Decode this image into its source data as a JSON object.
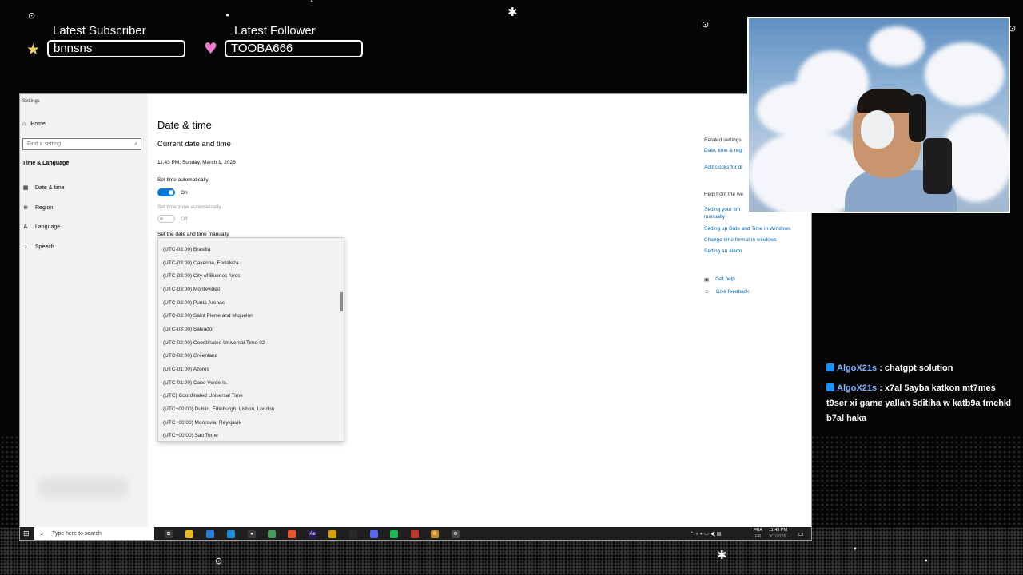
{
  "overlay": {
    "subscriber": {
      "title": "Latest Subscriber",
      "name": "bnnsns"
    },
    "follower": {
      "title": "Latest Follower",
      "name": "TOOBA666"
    }
  },
  "settings": {
    "window_title": "Settings",
    "home": "Home",
    "search_placeholder": "Find a setting",
    "section": "Time & Language",
    "nav": [
      {
        "label": "Date & time",
        "icon": "calendar-icon"
      },
      {
        "label": "Region",
        "icon": "globe-icon"
      },
      {
        "label": "Language",
        "icon": "language-icon"
      },
      {
        "label": "Speech",
        "icon": "microphone-icon"
      }
    ],
    "page_title": "Date & time",
    "current_heading": "Current date and time",
    "current_value": "11:43 PM, Sunday, March 1, 2026",
    "set_time_auto_label": "Set time automatically",
    "set_time_auto_state": "On",
    "set_tz_auto_label": "Set time zone automatically",
    "set_tz_auto_state": "Off",
    "manual_label": "Set the date and time manually",
    "timezones": [
      "(UTC-03:00) Brasilia",
      "(UTC-03:00) Cayenne, Fortaleza",
      "(UTC-03:00) City of Buenos Aires",
      "(UTC-03:00) Montevideo",
      "(UTC-03:00) Punta Arenas",
      "(UTC-03:00) Saint Pierre and Miquelon",
      "(UTC-03:00) Salvador",
      "(UTC-02:00) Coordinated Universal Time-02",
      "(UTC-02:00) Greenland",
      "(UTC-01:00) Azores",
      "(UTC-01:00) Cabo Verde Is.",
      "(UTC) Coordinated Universal Time",
      "(UTC+00:00) Dublin, Edinburgh, Lisbon, London",
      "(UTC+00:00) Monrovia, Reykjavik",
      "(UTC+00:00) Sao Tome"
    ],
    "related_title": "Related settings",
    "related_links": [
      "Date, time & regi",
      "Add clocks for di"
    ],
    "help_title": "Help from the we",
    "help_links": [
      "Setting your tim",
      "manually",
      "Setting up Date and Time in Windows",
      "Change time format in windows",
      "Setting an alarm"
    ],
    "get_help": "Get help",
    "give_feedback": "Give feedback"
  },
  "taskbar": {
    "search_placeholder": "Type here to search",
    "apps": [
      {
        "name": "task-view-icon",
        "color": "#3a3a3a",
        "glyph": "⧉"
      },
      {
        "name": "file-explorer-icon",
        "color": "#e8b92a",
        "glyph": ""
      },
      {
        "name": "store-icon",
        "color": "#2d7fd3",
        "glyph": ""
      },
      {
        "name": "edge-icon",
        "color": "#1a8fd8",
        "glyph": ""
      },
      {
        "name": "obs-icon",
        "color": "#3c3c3c",
        "glyph": "●"
      },
      {
        "name": "maps-icon",
        "color": "#4a9a5a",
        "glyph": ""
      },
      {
        "name": "brave-icon",
        "color": "#e8562a",
        "glyph": ""
      },
      {
        "name": "after-effects-icon",
        "color": "#2b1a5e",
        "glyph": "Ae"
      },
      {
        "name": "chrome-icon",
        "color": "#d9a200",
        "glyph": ""
      },
      {
        "name": "terminal-icon",
        "color": "#2b2b2b",
        "glyph": ""
      },
      {
        "name": "discord-icon",
        "color": "#5865f2",
        "glyph": ""
      },
      {
        "name": "spotify-icon",
        "color": "#1db954",
        "glyph": ""
      },
      {
        "name": "chrome-alt-icon",
        "color": "#c0392b",
        "glyph": ""
      },
      {
        "name": "app-icon",
        "color": "#c98a1a",
        "glyph": "B"
      },
      {
        "name": "settings-icon",
        "color": "#4a4a4a",
        "glyph": "⚙"
      }
    ],
    "lang": "FRA",
    "lang_sub": "FR",
    "time": "11:43 PM",
    "date": "3/1/2026"
  },
  "chat": [
    {
      "user": "AlgoX21s",
      "message": "chatgpt solution"
    },
    {
      "user": "AlgoX21s",
      "message": "x7al 5ayba katkon mt7mes t9ser xi game yallah 5ditiha w katb9a tmchkl b7al haka"
    }
  ]
}
